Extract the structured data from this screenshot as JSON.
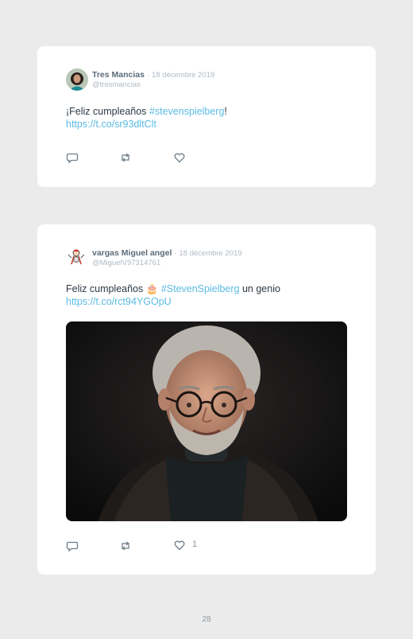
{
  "tweets": [
    {
      "name": "Tres Mancias",
      "separator": "·",
      "date": "18 décembre 2019",
      "handle": "@tresmancias",
      "text_before": "¡Feliz cumpleaños ",
      "hashtag": "#stevenspielberg",
      "text_after": "!",
      "link": "https://t.co/sr93dltClt",
      "likes": ""
    },
    {
      "name": "vargas Miguel angel",
      "separator": "·",
      "date": "18 décembre 2019",
      "handle": "@MiguelV97314761",
      "text_before": "Feliz cumpleaños ",
      "emoji": "🎂",
      "hashtag": "#StevenSpielberg",
      "text_after": " un genio",
      "link": "https://t.co/rct94YGOpU",
      "likes": "1"
    }
  ],
  "icons": {
    "reply": "reply-icon",
    "retweet": "retweet-icon",
    "like": "heart-icon"
  },
  "colors": {
    "link": "#5bbbe3",
    "background": "#ebebeb",
    "card": "#ffffff"
  },
  "page_number": "28"
}
